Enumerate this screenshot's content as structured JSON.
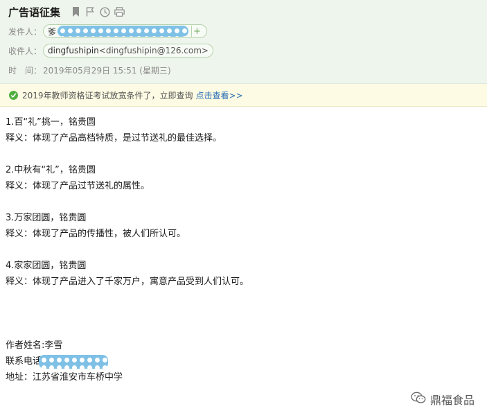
{
  "header": {
    "subject": "广告语征集",
    "icons": [
      "bookmark-icon",
      "flag-icon",
      "clock-icon",
      "print-icon"
    ],
    "sender_label": "发件人：",
    "sender_prefix": "爹",
    "recipient_label": "收件人：",
    "recipient_name": "dingfushipin",
    "recipient_email": "<dingfushipin@126.com>",
    "time_label": "时　间：",
    "time_value": "2019年05月29日 15:51 (星期三)"
  },
  "notice": {
    "text": "2019年教师资格证考试放宽条件了，立即查询",
    "link": "点击查看>>"
  },
  "body": {
    "items": [
      {
        "title": "1.百“礼”挑一，铭贵圆",
        "desc": "释义：体现了产品高档特质，是过节送礼的最佳选择。"
      },
      {
        "title": "2.中秋有“礼”，铭贵圆",
        "desc": "释义：体现了产品过节送礼的属性。"
      },
      {
        "title": "3.万家团圆，铭贵圆",
        "desc": "释义：体现了产品的传播性，被人们所认可。"
      },
      {
        "title": "4.家家团圆，铭贵圆",
        "desc": "释义：体现了产品进入了千家万户，寓意产品受到人们认可。"
      }
    ],
    "author": "作者姓名:李雪",
    "phone_label": "联系电话",
    "address": "地址：江苏省淮安市车桥中学"
  },
  "watermark": "鼎福食品"
}
